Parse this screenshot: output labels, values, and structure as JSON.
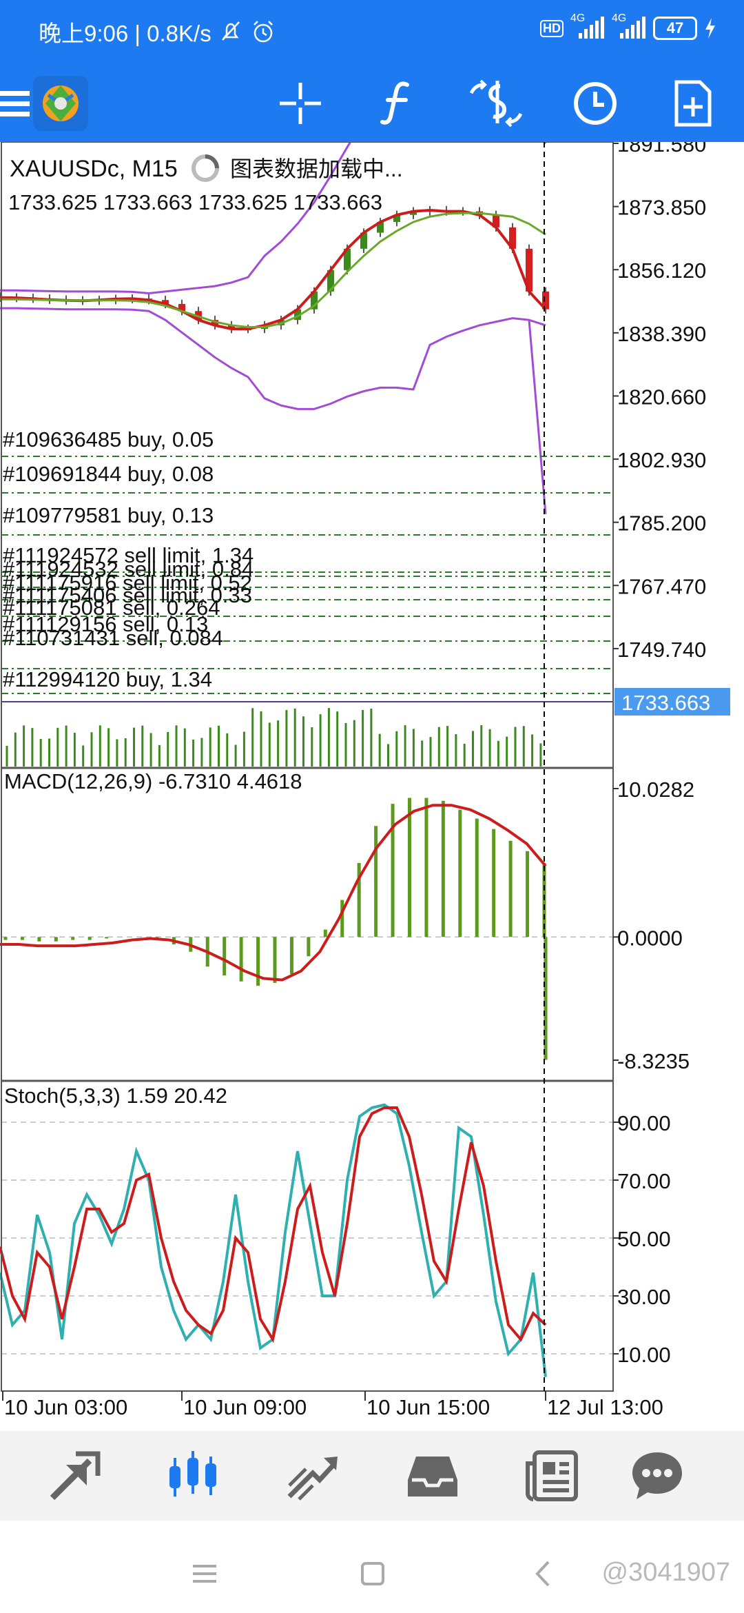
{
  "status_bar": {
    "time_speed": "晚上9:06 | 0.8K/s",
    "signal1_label": "4G",
    "signal2_label": "4G",
    "hd_label": "HD",
    "battery": "47"
  },
  "toolbar": {
    "icons": [
      "menu-icon",
      "app-logo",
      "crosshair-icon",
      "function-icon",
      "trade-icon",
      "clock-icon",
      "add-document-icon"
    ]
  },
  "chart": {
    "symbol_line": "XAUUSDc, M15",
    "loading_text": "图表数据加载中...",
    "ohlc_line": "1733.625 1733.663 1733.625 1733.663",
    "price_ticks": [
      "1891.580",
      "1873.850",
      "1856.120",
      "1838.390",
      "1820.660",
      "1802.930",
      "1785.200",
      "1767.470",
      "1749.740"
    ],
    "current_price": "1733.663",
    "orders": [
      "#109636485 buy, 0.05",
      "#109691844 buy, 0.08",
      "#109779581 buy, 0.13",
      "#111924572 sell limit, 1.34",
      "#111924532 sell limit, 0.84",
      "#111175916 sell limit, 0.52",
      "#111175406 sell limit, 0.33",
      "#111175081 sell, 0.264",
      "#111129156 sell, 0.13",
      "#110731431 sell, 0.084",
      "#112994120 buy, 1.34"
    ],
    "macd_label": "MACD(12,26,9) -6.7310 4.4618",
    "macd_ticks": [
      "10.0282",
      "0.0000",
      "-8.3235"
    ],
    "stoch_label": "Stoch(5,3,3) 1.59 20.42",
    "stoch_ticks": [
      "90.00",
      "70.00",
      "50.00",
      "30.00",
      "10.00"
    ],
    "time_labels": [
      "10 Jun 03:00",
      "10 Jun 09:00",
      "10 Jun 15:00",
      "12 Jul 13:00"
    ],
    "colors": {
      "bull": "#3c8a1e",
      "bear": "#d21f1f",
      "bands": "#a24bd6",
      "ma_fast": "#cc1c1c",
      "ma_slow": "#6aa82a",
      "macd_hist": "#5c9a1e",
      "stoch_main": "#2fb0b0",
      "stoch_signal": "#cc1c1c",
      "price_tag": "#4a9af0"
    }
  },
  "bottom_nav": {
    "items": [
      "quotes-icon",
      "chart-icon",
      "trade-icon",
      "history-icon",
      "news-icon",
      "chat-icon"
    ]
  },
  "system_nav": {
    "watermark": "@3041907"
  },
  "chart_data": [
    {
      "type": "line",
      "title": "XAUUSDc, M15",
      "ylim": [
        1733.663,
        1891.58
      ],
      "yticks": [
        1891.58,
        1873.85,
        1856.12,
        1838.39,
        1820.66,
        1802.93,
        1785.2,
        1767.47,
        1749.74
      ],
      "xticks": [
        "10 Jun 03:00",
        "10 Jun 09:00",
        "10 Jun 15:00",
        "12 Jul 13:00"
      ],
      "series": [
        {
          "values": [
            1848.3,
            1848.2,
            1848.0,
            1847.7,
            1847.5,
            1847.4,
            1847.6,
            1847.9,
            1848.0,
            1847.6,
            1846.5,
            1844.5,
            1842.0,
            1840.5,
            1839.5,
            1839.5,
            1840.5,
            1842.0,
            1845.0,
            1850.0,
            1856.0,
            1862.0,
            1866.5,
            1869.5,
            1871.5,
            1872.5,
            1872.8,
            1872.5,
            1872.5,
            1871.5,
            1868.0,
            1862.0,
            1850.0,
            1845.0
          ]
        },
        {
          "values": [
            1847.8,
            1847.8,
            1847.7,
            1847.6,
            1847.5,
            1847.5,
            1847.5,
            1847.5,
            1847.4,
            1847.0,
            1846.0,
            1844.5,
            1843.0,
            1841.5,
            1840.5,
            1840.0,
            1840.0,
            1841.0,
            1843.0,
            1846.0,
            1850.5,
            1855.5,
            1860.0,
            1864.0,
            1867.0,
            1869.5,
            1871.0,
            1871.8,
            1872.0,
            1872.0,
            1871.5,
            1871.0,
            1869.0,
            1866.0
          ]
        }
      ]
    },
    {
      "type": "bar",
      "title": "MACD(12,26,9)",
      "ylim": [
        -8.3235,
        10.0282
      ],
      "yticks": [
        10.0282,
        0.0,
        -8.3235
      ],
      "series": [
        {
          "values": [
            -0.2,
            -0.2,
            -0.3,
            -0.3,
            -0.2,
            -0.2,
            -0.1,
            0.0,
            0.0,
            -0.2,
            -0.5,
            -1.0,
            -2.0,
            -2.6,
            -3.0,
            -3.3,
            -3.1,
            -2.5,
            -1.3,
            0.5,
            2.5,
            5.0,
            7.5,
            9.0,
            9.4,
            9.4,
            9.2,
            8.6,
            8.0,
            7.3,
            6.5,
            5.8,
            5.0,
            -8.3
          ]
        },
        {
          "values": [
            -0.5,
            -0.5,
            -0.6,
            -0.6,
            -0.6,
            -0.5,
            -0.4,
            -0.2,
            -0.1,
            -0.2,
            -0.5,
            -1.0,
            -1.6,
            -2.3,
            -2.8,
            -2.9,
            -2.3,
            -1.0,
            1.2,
            3.8,
            6.0,
            7.6,
            8.5,
            8.9,
            8.9,
            8.6,
            8.0,
            7.2,
            6.3,
            4.8
          ]
        }
      ]
    },
    {
      "type": "line",
      "title": "Stoch(5,3,3)",
      "ylim": [
        0,
        100
      ],
      "yticks": [
        90,
        70,
        50,
        30,
        10
      ],
      "series": [
        {
          "values": [
            38,
            20,
            25,
            58,
            45,
            15,
            55,
            65,
            58,
            48,
            60,
            80,
            70,
            40,
            25,
            15,
            20,
            15,
            35,
            65,
            35,
            12,
            15,
            52,
            80,
            55,
            30,
            30,
            70,
            92,
            95,
            96,
            93,
            75,
            52,
            30,
            35,
            88,
            85,
            58,
            28,
            10,
            15,
            38,
            2
          ]
        },
        {
          "values": [
            47,
            30,
            22,
            45,
            40,
            22,
            40,
            60,
            60,
            52,
            55,
            70,
            72,
            50,
            35,
            25,
            20,
            17,
            25,
            50,
            45,
            22,
            15,
            35,
            60,
            68,
            45,
            30,
            55,
            85,
            93,
            95,
            95,
            85,
            65,
            42,
            35,
            60,
            83,
            68,
            42,
            20,
            15,
            24,
            20
          ]
        }
      ]
    }
  ]
}
